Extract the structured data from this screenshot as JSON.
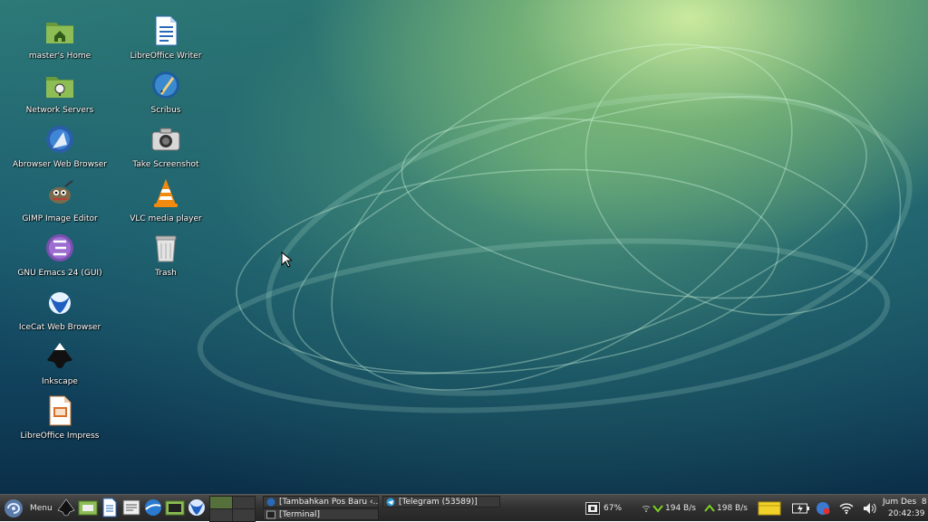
{
  "desktop": {
    "icons_col1": [
      {
        "label": "master's Home",
        "icon": "home-folder-icon"
      },
      {
        "label": "Network Servers",
        "icon": "network-folder-icon"
      },
      {
        "label": "Abrowser Web Browser",
        "icon": "abrowser-icon"
      },
      {
        "label": "GIMP Image Editor",
        "icon": "gimp-icon"
      },
      {
        "label": "GNU Emacs 24 (GUI)",
        "icon": "emacs-icon"
      },
      {
        "label": "IceCat Web Browser",
        "icon": "icecat-icon"
      },
      {
        "label": "Inkscape",
        "icon": "inkscape-icon"
      },
      {
        "label": "LibreOffice Impress",
        "icon": "impress-icon"
      }
    ],
    "icons_col2": [
      {
        "label": "LibreOffice Writer",
        "icon": "writer-icon"
      },
      {
        "label": "Scribus",
        "icon": "scribus-icon"
      },
      {
        "label": "Take Screenshot",
        "icon": "camera-icon"
      },
      {
        "label": "VLC media player",
        "icon": "vlc-icon"
      },
      {
        "label": "Trash",
        "icon": "trash-icon"
      }
    ]
  },
  "taskbar": {
    "menu_label": "Menu",
    "tasks": [
      {
        "label": "[Tambahkan Pos Baru ‹...",
        "icon": "browser-icon"
      },
      {
        "label": "[Telegram (53589)]",
        "icon": "telegram-icon"
      },
      {
        "label": "[Terminal]",
        "icon": "terminal-icon"
      }
    ],
    "battery_percent": "67%",
    "download_speed": "194 B/s",
    "upload_speed": "198 B/s",
    "clock_date": "Jum Des  8",
    "clock_time": "20:42:39"
  }
}
